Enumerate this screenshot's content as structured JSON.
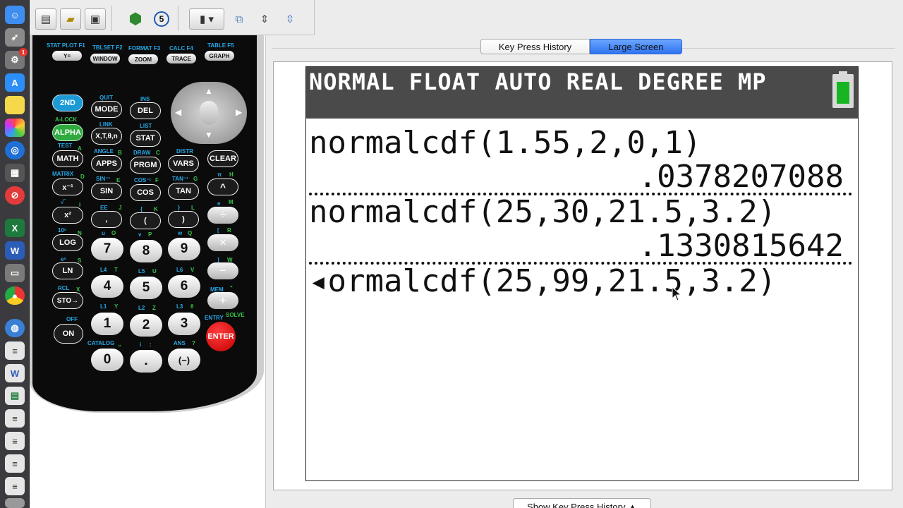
{
  "dock": {
    "icons": [
      "finder-icon",
      "rocket-icon",
      "system-prefs-icon",
      "app-store-icon",
      "notes-icon",
      "photos-icon",
      "safari-icon",
      "calculator-app-icon",
      "no-entry-icon",
      "excel-icon",
      "word-icon",
      "screenshot-icon",
      "chrome-icon",
      "globe-icon",
      "document-icon",
      "word-doc-icon",
      "spreadsheet-icon",
      "file-icon",
      "file-icon-2",
      "file-icon-3",
      "file-icon-4",
      "trash-icon"
    ],
    "badge": "1"
  },
  "toolbar": {
    "emulator_badge": "5"
  },
  "calculator": {
    "top_labels": [
      "STAT PLOT F1",
      "TBLSET F2",
      "FORMAT F3",
      "CALC F4",
      "TABLE F5"
    ],
    "top_keys": [
      "Y=",
      "WINDOW",
      "ZOOM",
      "TRACE",
      "GRAPH"
    ],
    "keys": {
      "second": "2ND",
      "mode": "MODE",
      "del": "DEL",
      "alpha": "ALPHA",
      "xton": "X,T,θ,n",
      "stat": "STAT",
      "math": "MATH",
      "apps": "APPS",
      "prgm": "PRGM",
      "vars": "VARS",
      "clear": "CLEAR",
      "inverse": "x⁻¹",
      "sin": "SIN",
      "cos": "COS",
      "tan": "TAN",
      "caret": "^",
      "square": "x²",
      "comma": ",",
      "lparen": "(",
      "rparen": ")",
      "divide": "÷",
      "log": "LOG",
      "seven": "7",
      "eight": "8",
      "nine": "9",
      "multiply": "×",
      "ln": "LN",
      "four": "4",
      "five": "5",
      "six": "6",
      "minus": "−",
      "sto": "STO→",
      "one": "1",
      "two": "2",
      "three": "3",
      "plus": "+",
      "on": "ON",
      "zero": "0",
      "dot": ".",
      "neg": "(−)",
      "enter": "ENTER"
    },
    "secondary_labels": {
      "quit": "QUIT",
      "ins": "INS",
      "alock": "A-LOCK",
      "link": "LINK",
      "list": "LIST",
      "test": "TEST",
      "testa": "A",
      "angle": "ANGLE",
      "angleb": "B",
      "draw": "DRAW",
      "drawc": "C",
      "distr": "DISTR",
      "matrix": "MATRIX",
      "matrixd": "D",
      "sininv": "SIN⁻¹",
      "sininve": "E",
      "cosinv": "COS⁻¹",
      "cosinvf": "F",
      "taninv": "TAN⁻¹",
      "taninvg": "G",
      "pi": "π",
      "pih": "H",
      "sqrt": "√‾",
      "sqrti": "I",
      "ee": "EE",
      "eej": "J",
      "lbrace": "{",
      "lbracek": "K",
      "rbrace": "}",
      "rbracel": "L",
      "e": "e",
      "em": "M",
      "ten": "10ˣ",
      "tenn": "N",
      "u": "u",
      "uo": "O",
      "v": "v",
      "vp": "P",
      "w": "w",
      "wq": "Q",
      "lbracket": "[",
      "lbracketr": "R",
      "ex": "eˣ",
      "exs": "S",
      "l4": "L4",
      "l4t": "T",
      "l5": "L5",
      "l5u": "U",
      "l6": "L6",
      "l6v": "V",
      "rbracket": "]",
      "rbracketw": "W",
      "rcl": "RCL",
      "rclx": "X",
      "l1": "L1",
      "l1y": "Y",
      "l2": "L2",
      "l2z": "Z",
      "l3": "L3",
      "l3t": "θ",
      "mem": "MEM",
      "memq": "\"",
      "off": "OFF",
      "catalog": "CATALOG",
      "catsp": "⎵",
      "i": "i",
      "icolon": ":",
      "ans": "ANS",
      "ansq": "?",
      "entry": "ENTRY",
      "solve": "SOLVE"
    }
  },
  "tabs": {
    "history": "Key Press History",
    "large_screen": "Large Screen"
  },
  "screen": {
    "status": "NORMAL FLOAT AUTO REAL DEGREE MP",
    "lines": [
      {
        "input": "normalcdf(1.55,2,0,1)",
        "result": ".0378207088"
      },
      {
        "input": "normalcdf(25,30,21.5,3.2)",
        "result": ".1330815642"
      },
      {
        "input": "◂ormalcdf(25,99,21.5,3.2)"
      }
    ]
  },
  "show_history_button": "Show Key Press History ▲"
}
